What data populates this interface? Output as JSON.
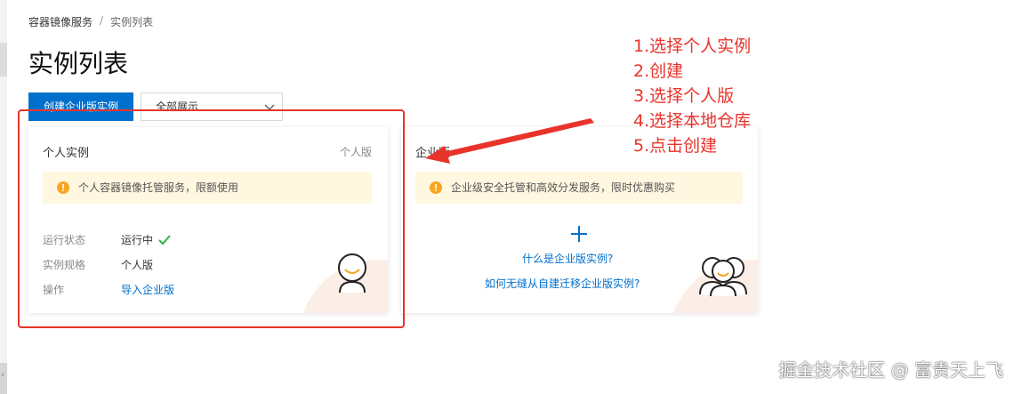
{
  "breadcrumb": {
    "root": "容器镜像服务",
    "separator": "/",
    "current": "实例列表"
  },
  "page": {
    "title": "实例列表"
  },
  "toolbar": {
    "create_button": "创建企业版实例",
    "filter_value": "全部展示"
  },
  "personal_card": {
    "title": "个人实例",
    "tag": "个人版",
    "notice": "个人容器镜像托管服务，限额使用",
    "rows": [
      {
        "label": "运行状态",
        "value": "运行中"
      },
      {
        "label": "实例规格",
        "value": "个人版"
      },
      {
        "label": "操作",
        "value": "导入企业版"
      }
    ]
  },
  "enterprise_card": {
    "title": "企业版",
    "notice": "企业级安全托管和高效分发服务，限时优惠购买",
    "link_what": "什么是企业版实例?",
    "link_migrate": "如何无缝从自建迁移企业版实例?"
  },
  "annotations": [
    "1.选择个人实例",
    "2.创建",
    "3.选择个人版",
    "4.选择本地仓库",
    "5.点击创建"
  ],
  "watermark": "掘金技术社区 @ 富贵天上飞",
  "colors": {
    "primary": "#0070cc",
    "annotation_red": "#e8332b",
    "notice_bg": "#fff7e0",
    "success": "#2fb344",
    "warning": "#f5a623"
  },
  "icons": [
    "chevron-down-icon",
    "warning-icon",
    "check-icon",
    "plus-icon",
    "user-avatar-icon",
    "group-avatar-icon",
    "red-arrow"
  ]
}
